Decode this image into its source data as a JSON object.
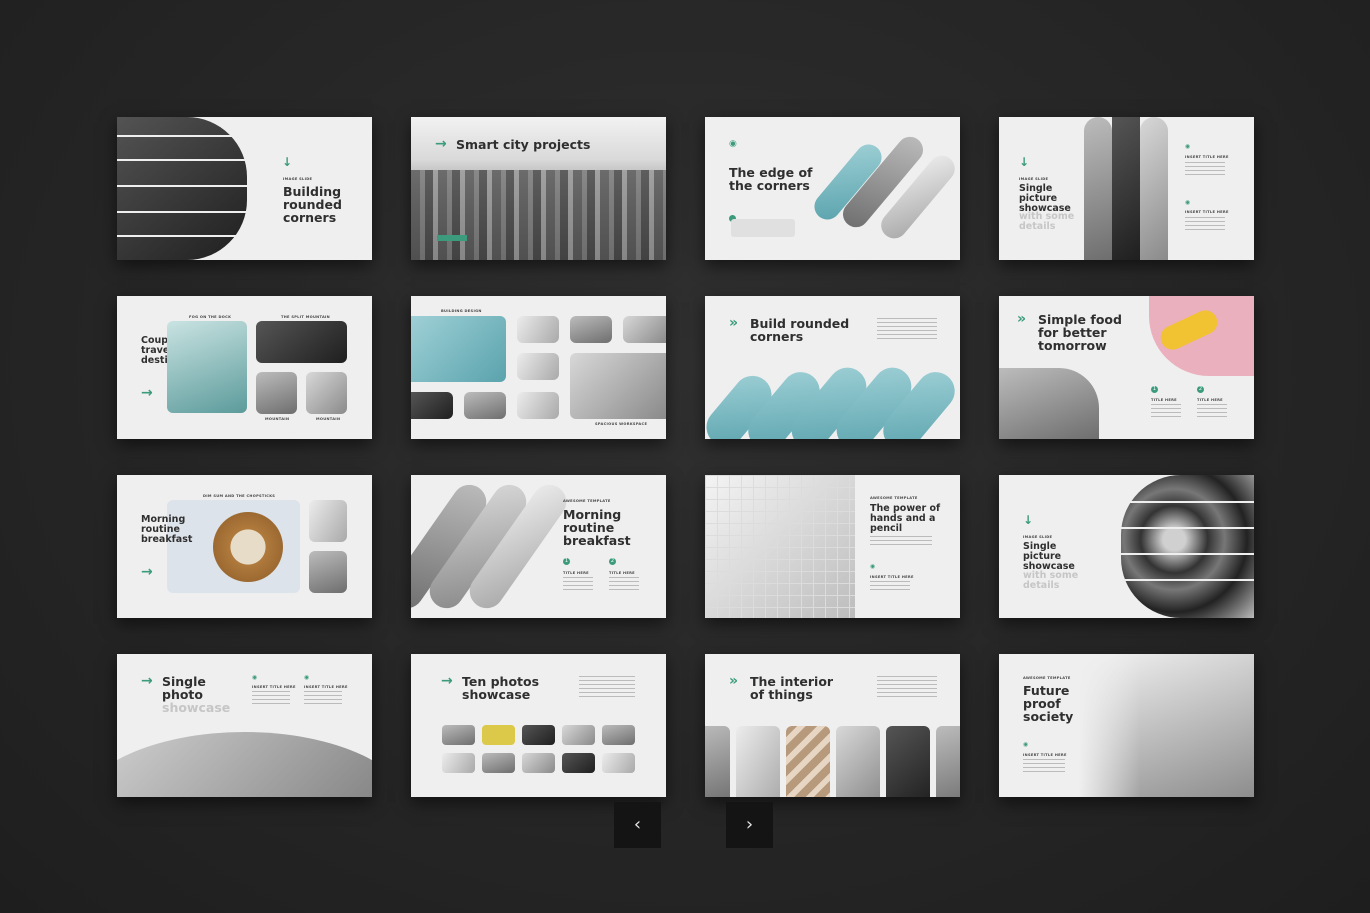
{
  "accent": "#3c9b7c",
  "background": "#262626",
  "slides": [
    {
      "title": "Building\nrounded\ncorners",
      "kicker": "IMAGE SLIDE"
    },
    {
      "title": "Smart city projects"
    },
    {
      "title": "The edge of\nthe corners"
    },
    {
      "title": "Single\npicture\nshowcase",
      "muted": "with some\ndetails",
      "kicker": "IMAGE SLIDE",
      "cap1": "INSERT TITLE HERE",
      "cap2": "INSERT TITLE HERE"
    },
    {
      "title": "Couple\ntravel\ndestinations",
      "cap1": "FOG ON THE DOCK",
      "cap2": "THE SPLIT MOUNTAIN",
      "cap3": "MOUNTAIN",
      "cap4": "MOUNTAIN"
    },
    {
      "kicker": "BUILDING DESIGN",
      "cap": "SPACIOUS WORKSPACE"
    },
    {
      "title": "Build rounded\ncorners"
    },
    {
      "title": "Simple food\nfor better\ntomorrow",
      "n1": "1",
      "n2": "2",
      "cap1": "TITLE HERE",
      "cap2": "TITLE HERE"
    },
    {
      "title": "Morning\nroutine\nbreakfast",
      "kicker": "DIM SUM AND THE CHOPSTICKS"
    },
    {
      "title": "Morning\nroutine\nbreakfast",
      "kicker": "AWESOME TEMPLATE",
      "n1": "1",
      "n2": "2",
      "cap1": "TITLE HERE",
      "cap2": "TITLE HERE"
    },
    {
      "title": "The power of\nhands and a\npencil",
      "kicker": "AWESOME TEMPLATE",
      "cap": "INSERT TITLE HERE"
    },
    {
      "title": "Single\npicture\nshowcase",
      "muted": "with some\ndetails",
      "kicker": "IMAGE SLIDE"
    },
    {
      "title": "Single\nphoto",
      "muted": "showcase",
      "cap1": "INSERT TITLE HERE",
      "cap2": "INSERT TITLE HERE"
    },
    {
      "title": "Ten photos\nshowcase"
    },
    {
      "title": "The interior\nof things"
    },
    {
      "title": "Future\nproof\nsociety",
      "kicker": "AWESOME TEMPLATE",
      "cap": "INSERT TITLE HERE"
    }
  ],
  "nav": {
    "prev_icon": "chevron-left-icon",
    "next_icon": "chevron-right-icon",
    "prev_glyph": "‹",
    "next_glyph": "›"
  }
}
